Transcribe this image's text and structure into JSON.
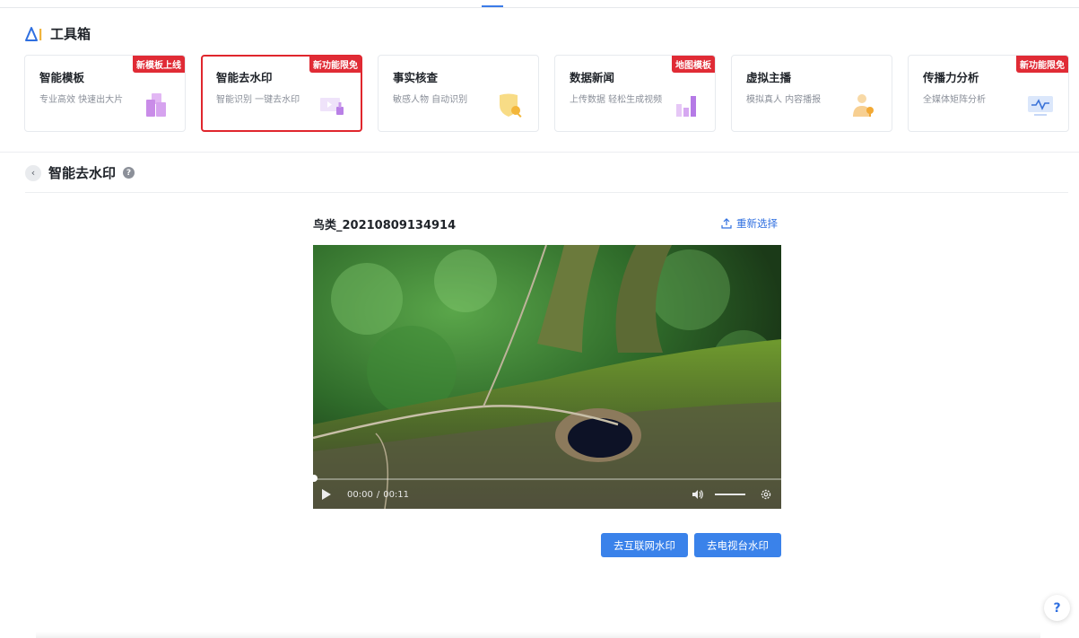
{
  "toolbox": {
    "title": "工具箱"
  },
  "cards": [
    {
      "title": "智能模板",
      "desc": "专业高效 快速出大片",
      "badge": "新模板上线",
      "icon": "template-blocks-icon",
      "color": "#c98ce8"
    },
    {
      "title": "智能去水印",
      "desc": "智能识别 一键去水印",
      "badge": "新功能限免",
      "icon": "watermark-remove-icon",
      "color": "#b98ae2"
    },
    {
      "title": "事实核查",
      "desc": "敏感人物 自动识别",
      "badge": "",
      "icon": "shield-search-icon",
      "color": "#f3c64a"
    },
    {
      "title": "数据新闻",
      "desc": "上传数据 轻松生成视频",
      "badge": "地图模板",
      "icon": "bar-chart-icon",
      "color": "#b57ae6"
    },
    {
      "title": "虚拟主播",
      "desc": "模拟真人 内容播报",
      "badge": "",
      "icon": "anchor-person-icon",
      "color": "#f2b558"
    },
    {
      "title": "传播力分析",
      "desc": "全媒体矩阵分析",
      "badge": "新功能限免",
      "icon": "monitor-wave-icon",
      "color": "#5b8be6"
    }
  ],
  "section": {
    "title": "智能去水印"
  },
  "file": {
    "name": "鸟类_20210809134914",
    "reselect_label": "重新选择"
  },
  "player": {
    "current_time": "00:00",
    "separator": "/",
    "duration": "00:11",
    "progress": 0.0,
    "volume": 1.0
  },
  "actions": {
    "remove_internet_label": "去互联网水印",
    "remove_tv_label": "去电视台水印"
  },
  "help": {
    "label": "?"
  },
  "colors": {
    "accent": "#3a82ea",
    "badge": "#e02b35",
    "selected_border": "#e0262d"
  }
}
